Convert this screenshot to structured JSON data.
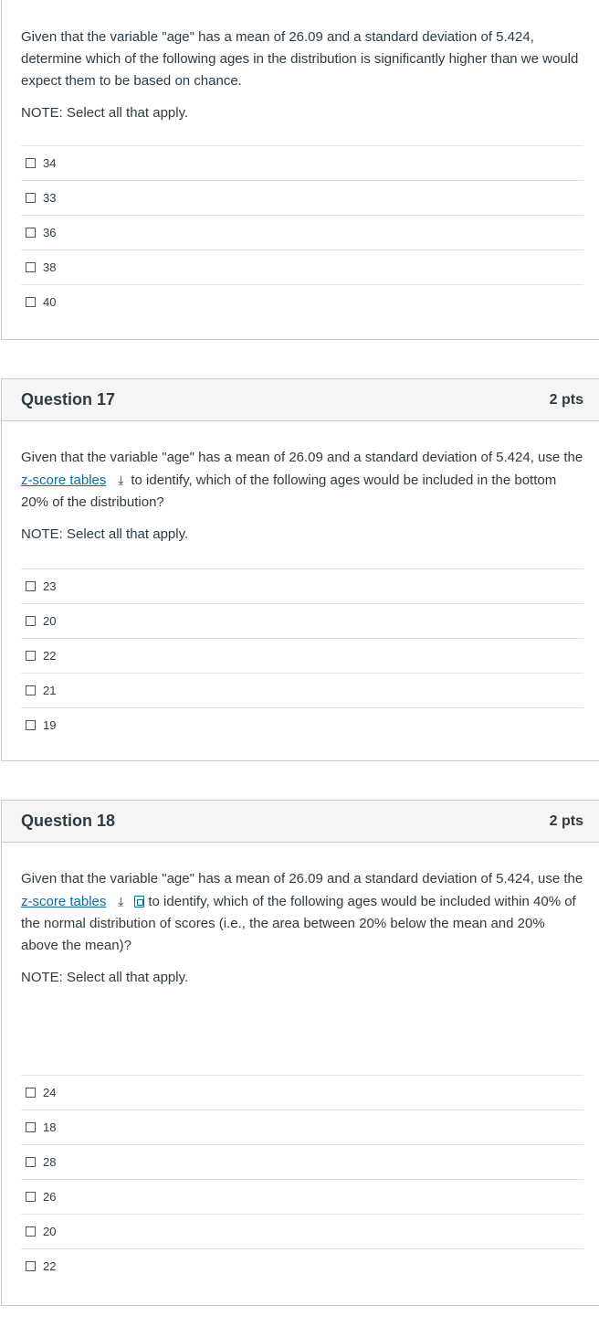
{
  "q16": {
    "text": "Given that the variable \"age\" has a mean of 26.09 and a standard deviation of 5.424, determine which of the following ages in the distribution is significantly higher than we would expect them to be based on chance.",
    "note": "NOTE: Select all that apply.",
    "answers": [
      "34",
      "33",
      "36",
      "38",
      "40"
    ]
  },
  "q17": {
    "title": "Question 17",
    "points": "2 pts",
    "text_before": "Given that the variable \"age\" has a mean of 26.09 and a standard deviation of 5.424, use the",
    "link": "z-score tables",
    "text_after": "to identify, which of the following ages would be included in the bottom 20% of the distribution?",
    "note": "NOTE: Select all that apply.",
    "answers": [
      "23",
      "20",
      "22",
      "21",
      "19"
    ]
  },
  "q18": {
    "title": "Question 18",
    "points": "2 pts",
    "text_before": "Given that the variable \"age\" has a mean of 26.09 and a standard deviation of 5.424, use the",
    "link": "z-score tables",
    "text_after": "to identify, which of the following ages would be included within 40% of the normal distribution of scores (i.e., the area between 20% below the mean and 20% above the mean)?",
    "note": "NOTE: Select all that apply.",
    "answers": [
      "24",
      "18",
      "28",
      "26",
      "20",
      "22"
    ]
  },
  "icons": {
    "download": "download-icon",
    "document": "document-preview-icon"
  },
  "colors": {
    "link": "#0770a3",
    "header_bg": "#f5f5f5",
    "text": "#2d3b45",
    "border": "#c7cdd1"
  }
}
